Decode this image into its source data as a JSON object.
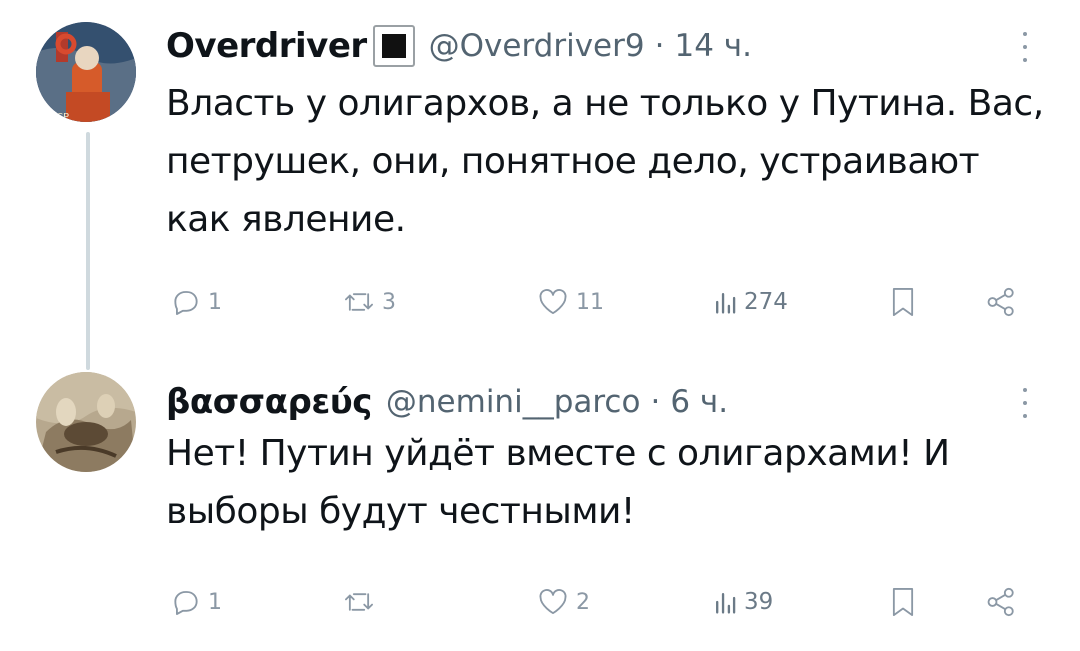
{
  "tweets": [
    {
      "author": {
        "display_name": "Overdriver",
        "badge_icon": "black-square-icon",
        "handle": "@Overdriver9"
      },
      "separator": "·",
      "time": "14 ч.",
      "text": "Власть у олигархов, а не только у Путина. Вас, петрушек, они, понятное дело, устраивают как явление.",
      "stats": {
        "replies": "1",
        "retweets": "3",
        "likes": "11",
        "views": "274"
      }
    },
    {
      "author": {
        "display_name": "βασσαρεύς",
        "handle": "@nemini__parco"
      },
      "separator": "·",
      "time": "6 ч.",
      "text": "Нет! Путин уйдёт вместе с олигархами! И выборы будут честными!",
      "stats": {
        "replies": "1",
        "retweets": "",
        "likes": "2",
        "views": "39"
      }
    }
  ],
  "colors": {
    "text_primary": "#0f1419",
    "text_secondary": "#536471",
    "icon": "#8b98a5",
    "thread_line": "#cfd9de"
  }
}
